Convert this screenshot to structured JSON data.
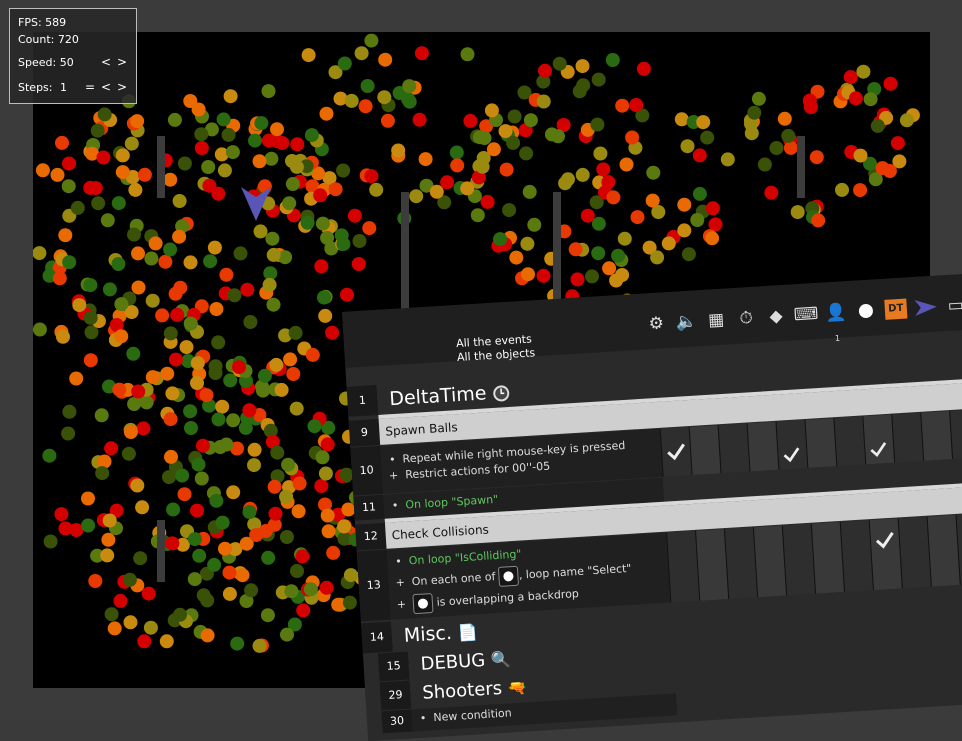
{
  "hud": {
    "fps_label": "FPS:",
    "fps_value": "589",
    "count_label": "Count:",
    "count_value": "720",
    "speed_label": "Speed:",
    "speed_value": "50",
    "steps_label": "Steps:",
    "steps_value": "1",
    "equals": "=",
    "prev": "<",
    "next": ">"
  },
  "sheet": {
    "filter_events": "All the events",
    "filter_objects": "All the objects",
    "toolbar_badge": "1",
    "dt_label": "DT",
    "rows": {
      "r1": {
        "num": "1",
        "title": "DeltaTime"
      },
      "r9": {
        "num": "9",
        "title": "Spawn Balls"
      },
      "r10": {
        "num": "10",
        "line1": "Repeat while right mouse-key is pressed",
        "line2": "Restrict actions for 00''-05",
        "bullet": "•",
        "plus": "+"
      },
      "r11": {
        "num": "11",
        "line": "On loop \"Spawn\"",
        "bullet": "•"
      },
      "r12": {
        "num": "12",
        "title": "Check Collisions"
      },
      "r13": {
        "num": "13",
        "line1": "On loop \"IsColliding\"",
        "line2a": "On each one of",
        "line2b": ", loop name \"Select\"",
        "line3": "is overlapping a backdrop",
        "bullet": "•",
        "plus": "+"
      },
      "r14": {
        "num": "14",
        "title": "Misc."
      },
      "r15": {
        "num": "15",
        "title": "DEBUG"
      },
      "r29": {
        "num": "29",
        "title": "Shooters"
      },
      "r30": {
        "num": "30",
        "line": "New condition"
      }
    }
  },
  "colors": {
    "arena_bg": "#000000",
    "frame": "#3b3b3b",
    "player": "#5a56b8",
    "ball_palette": [
      "#d40000",
      "#e83a00",
      "#e86a00",
      "#c98a10",
      "#9a8a10",
      "#5a7a10",
      "#2a6a10",
      "#3a5208"
    ]
  }
}
